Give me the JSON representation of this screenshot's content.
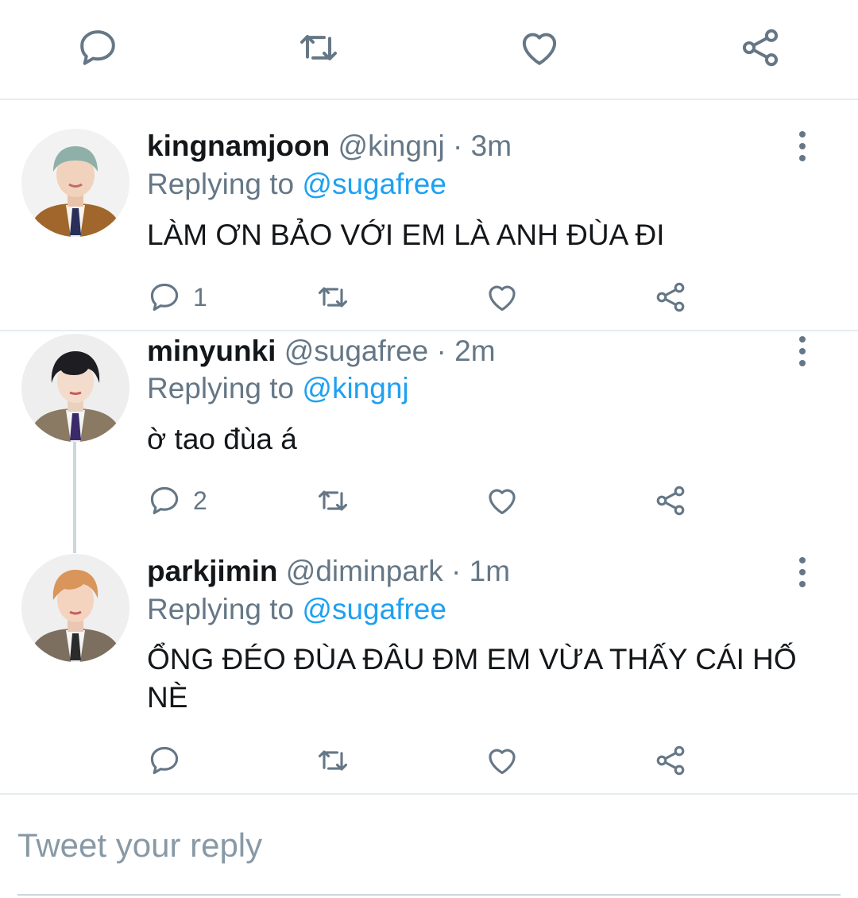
{
  "top_actions": {
    "icons": [
      "reply-icon",
      "retweet-icon",
      "like-icon",
      "share-icon"
    ]
  },
  "tweets": [
    {
      "display_name": "kingnamjoon",
      "handle": "@kingnj",
      "time": "· 3m",
      "replying_prefix": "Replying to ",
      "replying_to": "@sugafree",
      "text": "LÀM ƠN BẢO VỚI EM LÀ ANH ĐÙA ĐI",
      "reply_count": "1",
      "avatar_palette": {
        "hair": "#8fb0a8",
        "skin": "#f1d3bd",
        "jacket": "#a0662c",
        "tie": "#2a2f5a",
        "bg": "#f2f2f2"
      }
    },
    {
      "display_name": "minyunki",
      "handle": "@sugafree",
      "time": "· 2m",
      "replying_prefix": "Replying to ",
      "replying_to": "@kingnj",
      "text": "ờ tao đùa á",
      "reply_count": "2",
      "avatar_palette": {
        "hair": "#1d1d22",
        "skin": "#f3dccc",
        "jacket": "#8a7a63",
        "tie": "#3b2a6a",
        "bg": "#eeeeee"
      }
    },
    {
      "display_name": "parkjimin",
      "handle": "@diminpark",
      "time": "· 1m",
      "replying_prefix": "Replying to ",
      "replying_to": "@sugafree",
      "text": "ỔNG ĐÉO ĐÙA ĐÂU ĐM EM VỪA THẤY CÁI HỐ NÈ",
      "reply_count": "",
      "avatar_palette": {
        "hair": "#d9955a",
        "skin": "#f4d4bf",
        "jacket": "#7c6f60",
        "tie": "#2b2b2b",
        "bg": "#efefef"
      }
    }
  ],
  "reply_box": {
    "placeholder": "Tweet your reply"
  },
  "colors": {
    "accent": "#1da1f2",
    "icon": "#657786",
    "divider": "#e6ecf0"
  }
}
